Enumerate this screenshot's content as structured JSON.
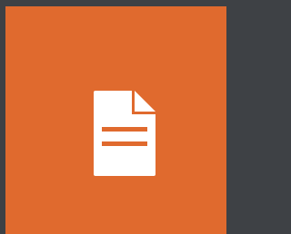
{
  "colors": {
    "frame_background": "#3e4145",
    "tile_background": "#e06a2e",
    "icon_color": "#ffffff"
  },
  "tile": {
    "icon": "document-icon"
  }
}
